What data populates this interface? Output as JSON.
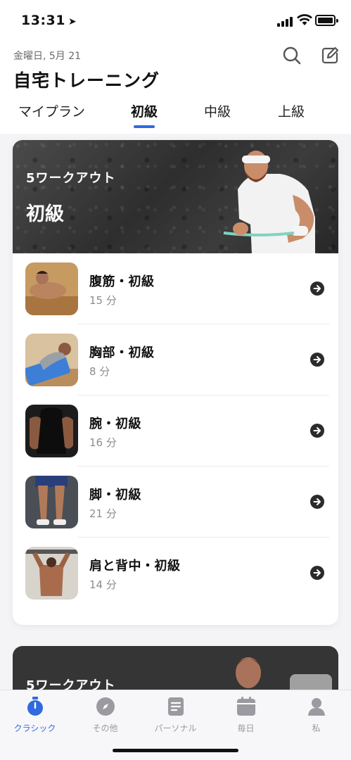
{
  "status_bar": {
    "time": "13:31"
  },
  "header": {
    "date": "金曜日, 5月 21",
    "title": "自宅トレーニング",
    "search_icon": "search-icon",
    "edit_icon": "edit-icon"
  },
  "level_tabs": [
    {
      "label": "マイプラン",
      "active": false
    },
    {
      "label": "初級",
      "active": true
    },
    {
      "label": "中級",
      "active": false
    },
    {
      "label": "上級",
      "active": false
    }
  ],
  "level_card": {
    "workout_count": "5ワークアウト",
    "level_title": "初級",
    "items": [
      {
        "name": "腹筋・初級",
        "duration": "15 分"
      },
      {
        "name": "胸部・初級",
        "duration": "8 分"
      },
      {
        "name": "腕・初級",
        "duration": "16 分"
      },
      {
        "name": "脚・初級",
        "duration": "21 分"
      },
      {
        "name": "肩と背中・初級",
        "duration": "14 分"
      }
    ]
  },
  "next_card": {
    "workout_count": "5ワークアウト"
  },
  "bottom_tabs": [
    {
      "label": "クラシック",
      "icon": "stopwatch-icon",
      "active": true
    },
    {
      "label": "その他",
      "icon": "compass-icon",
      "active": false
    },
    {
      "label": "パーソナル",
      "icon": "document-icon",
      "active": false
    },
    {
      "label": "毎日",
      "icon": "calendar-icon",
      "active": false
    },
    {
      "label": "私",
      "icon": "profile-icon",
      "active": false
    }
  ],
  "colors": {
    "accent": "#2f6ae0",
    "banner": "#3a3a3a",
    "text_secondary": "#8d8d92"
  }
}
